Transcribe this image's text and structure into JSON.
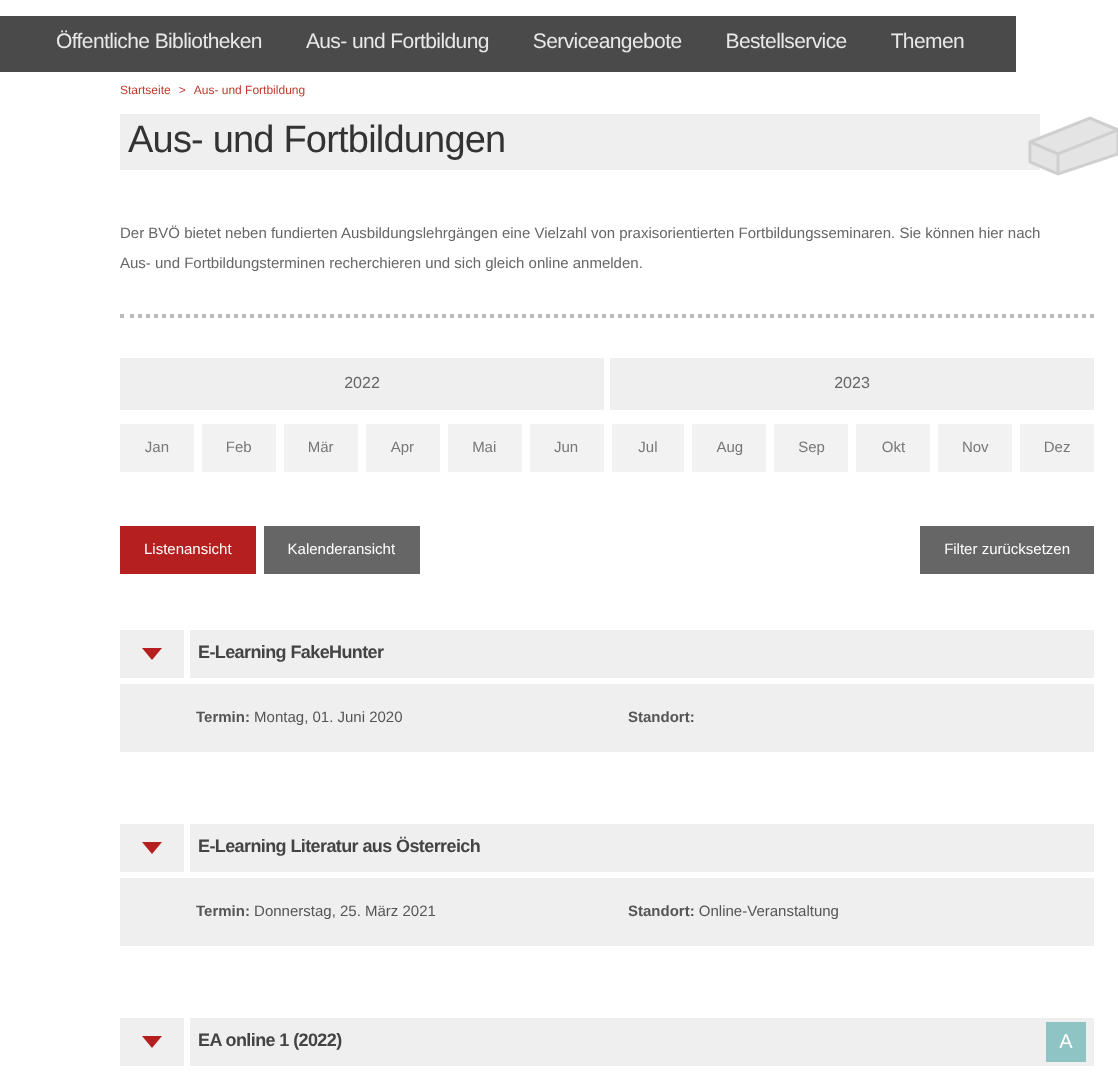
{
  "nav": [
    "Öffentliche Bibliotheken",
    "Aus- und Fortbildung",
    "Serviceangebote",
    "Bestellservice",
    "Themen"
  ],
  "breadcrumb": [
    "Startseite",
    "Aus- und Fortbildung"
  ],
  "breadcrumb_separator": ">",
  "title": "Aus- und Fortbildungen",
  "intro": "Der BVÖ bietet neben fundierten Ausbildungslehrgängen eine Vielzahl von praxisorientierten Fortbildungsseminaren. Sie können hier nach Aus- und Fortbildungsterminen recherchieren und sich gleich online anmelden.",
  "years": [
    "2022",
    "2023"
  ],
  "months": [
    "Jan",
    "Feb",
    "Mär",
    "Apr",
    "Mai",
    "Jun",
    "Jul",
    "Aug",
    "Sep",
    "Okt",
    "Nov",
    "Dez"
  ],
  "view_buttons": [
    {
      "label": "Listenansicht",
      "selected": true
    },
    {
      "label": "Kalenderansicht",
      "selected": false
    }
  ],
  "reset_button": "Filter zurücksetzen",
  "events": [
    {
      "title": "E-Learning FakeHunter",
      "termin_label": "Termin:",
      "termin": "Montag, 01. Juni 2020",
      "standort_label": "Standort:"
    },
    {
      "title": "E-Learning Literatur aus Österreich",
      "termin_label": "Termin:",
      "termin": "Donnerstag, 25. März 2021",
      "standort_label": "Standort:",
      "standort": "Online-Veranstaltung"
    },
    {
      "title": "EA online 1 (2022)",
      "badge": "A"
    }
  ]
}
